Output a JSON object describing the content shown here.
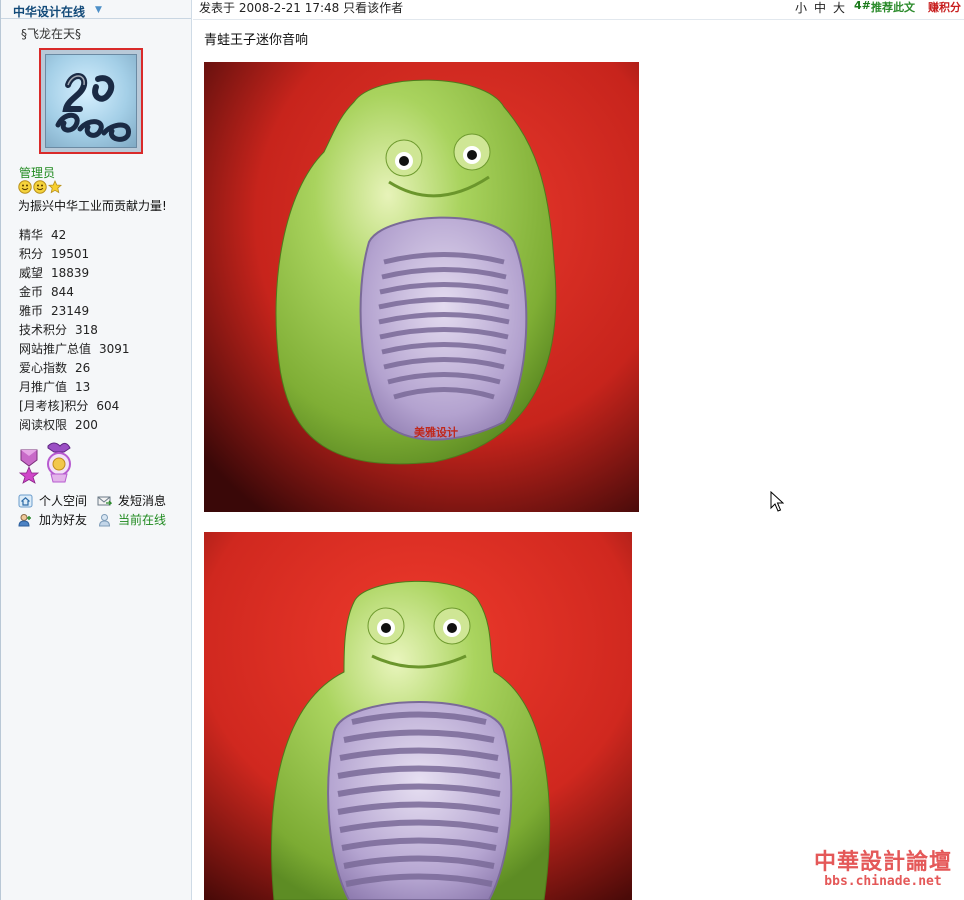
{
  "sidebar": {
    "forum_name": "中华设计在线",
    "username": "§飞龙在天§",
    "role": "管理员",
    "motto": "为振兴中华工业而贡献力量!",
    "stats": [
      {
        "label": "精华",
        "value": "42"
      },
      {
        "label": "积分",
        "value": "19501"
      },
      {
        "label": "威望",
        "value": "18839"
      },
      {
        "label": "金币",
        "value": "844"
      },
      {
        "label": "雅币",
        "value": "23149"
      },
      {
        "label": "技术积分",
        "value": "318"
      },
      {
        "label": "网站推广总值",
        "value": "3091"
      },
      {
        "label": "爱心指数",
        "value": "26"
      },
      {
        "label": "月推广值",
        "value": "13"
      },
      {
        "label": "[月考核]积分",
        "value": "604"
      },
      {
        "label": "阅读权限",
        "value": "200"
      }
    ],
    "actions": {
      "space": "个人空间",
      "message": "发短消息",
      "add_friend": "加为好友",
      "online": "当前在线"
    }
  },
  "post": {
    "posted_label": "发表于  2008-2-21 17:48  只看该作者",
    "font_small": "小",
    "font_medium": "中",
    "font_large": "大",
    "floor": "4#",
    "recommend": "推荐此文",
    "score": "赚积分",
    "title": "青蛙王子迷你音响",
    "photo_caption": "美雅设计"
  },
  "watermark": {
    "title": "中華設計論壇",
    "url": "bbs.chinade.net"
  },
  "colors": {
    "photo_red": "#d62c22",
    "frog_green": "#9cc94e",
    "grille_lavender": "#b9a8d4",
    "link_green": "#1f8a1f",
    "accent_red": "#c81e1e"
  }
}
